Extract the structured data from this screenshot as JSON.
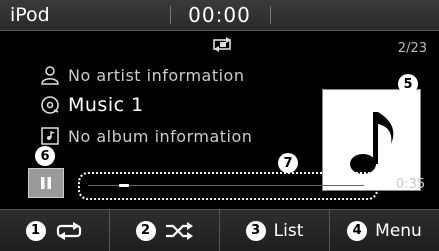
{
  "topbar": {
    "source": "iPod",
    "clock": "00:00"
  },
  "main": {
    "track_counter": "2/23",
    "artist": "No artist information",
    "title": "Music 1",
    "album": "No album information",
    "elapsed": "0:35",
    "progress_fraction": 0.14
  },
  "callouts": {
    "album_art": "5",
    "pause": "6",
    "progress": "7"
  },
  "softkeys": [
    {
      "num": "1",
      "label": "",
      "icon": "repeat-icon"
    },
    {
      "num": "2",
      "label": "",
      "icon": "shuffle-icon"
    },
    {
      "num": "3",
      "label": "List",
      "icon": ""
    },
    {
      "num": "4",
      "label": "Menu",
      "icon": ""
    }
  ]
}
